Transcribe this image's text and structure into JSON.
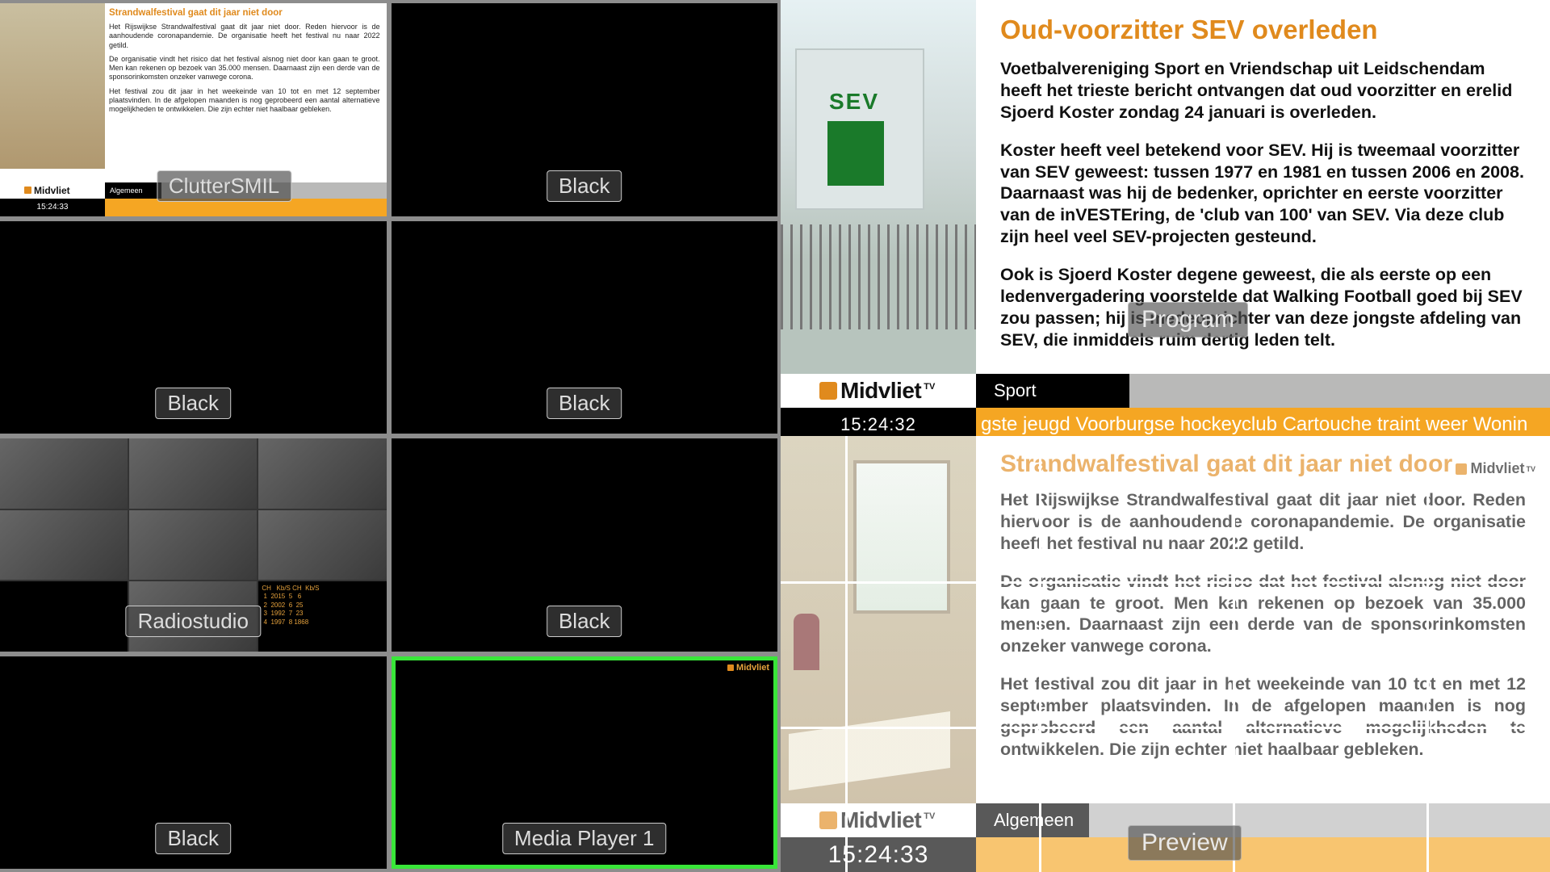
{
  "brand": {
    "name": "Midvliet",
    "suffix": "TV"
  },
  "program": {
    "source_label": "Program",
    "headline": "Oud-voorzitter SEV overleden",
    "photo_sign": "SEV",
    "paragraphs": [
      "Voetbalvereniging Sport en Vriendschap uit Leidschendam heeft het trieste bericht ontvangen dat oud voorzitter en erelid Sjoerd Koster zondag 24 januari is overleden.",
      "Koster heeft veel betekend voor SEV. Hij is tweemaal voorzitter van SEV geweest: tussen 1977 en 1981 en tussen 2006 en 2008. Daarnaast was hij de bedenker, oprichter en eerste voorzitter van de inVESTEring, de 'club van 100' van SEV. Via deze club zijn heel veel SEV-projecten gesteund.",
      "Ook is Sjoerd Koster degene geweest, die als eerste op een ledenvergadering voorstelde dat Walking Football goed bij SEV zou passen; hij is medeoprichter van deze jongste afdeling van SEV, die inmiddels ruim dertig leden telt."
    ],
    "category": "Sport",
    "time": "15:24:32",
    "ticker": "gste jeugd Voorburgse hockeyclub Cartouche traint weer        Wonin"
  },
  "preview": {
    "source_label": "Preview",
    "headline": "Strandwalfestival gaat dit jaar niet door",
    "paragraphs": [
      "Het Rijswijkse Strandwalfestival gaat dit jaar niet door. Reden hiervoor is de aanhoudende coronapandemie. De organisatie heeft het festival nu naar 2022 getild.",
      "De organisatie vindt het risico dat het festival alsnog niet door kan gaan te groot. Men kan rekenen op bezoek van 35.000 mensen. Daarnaast zijn een derde van de sponsorinkomsten onzeker vanwege corona.",
      "Het festival zou dit jaar in het weekeinde van 10 tot en met 12 september plaatsvinden. In de afgelopen maanden is nog geprobeerd een aantal alternatieve mogelijkheden te ontwikkelen. Die zijn echter niet haalbaar gebleken."
    ],
    "category": "Algemeen",
    "time": "15:24:33"
  },
  "mv": {
    "cells": [
      {
        "label": "ClutterSMIL",
        "selected": true
      },
      {
        "label": "Black",
        "selected": false
      },
      {
        "label": "Black",
        "selected": false
      },
      {
        "label": "Black",
        "selected": false
      },
      {
        "label": "Radiostudio",
        "selected": false
      },
      {
        "label": "Black",
        "selected": false
      },
      {
        "label": "Black",
        "selected": false
      },
      {
        "label": "Media Player 1",
        "selected": true
      }
    ],
    "mini": {
      "headline": "Strandwalfestival gaat dit jaar niet door",
      "paragraphs": [
        "Het Rijswijkse Strandwalfestival gaat dit jaar niet door. Reden hiervoor is de aanhoudende coronapandemie. De organisatie heeft het festival nu naar 2022 getild.",
        "De organisatie vindt het risico dat het festival alsnog niet door kan gaan te groot. Men kan rekenen op bezoek van 35.000 mensen. Daarnaast zijn een derde van de sponsorinkomsten onzeker vanwege corona.",
        "Het festival zou dit jaar in het weekeinde van 10 tot en met 12 september plaatsvinden. In de afgelopen maanden is nog geprobeerd een aantal alternatieve mogelijkheden te ontwikkelen. Die zijn echter niet haalbaar gebleken."
      ],
      "category": "Algemeen",
      "time": "15:24:33"
    },
    "radiostudio_meta": "CH   Kb/S CH  Kb/S\n 1  2015  5   6\n 2  2002  6  25\n 3  1992  7  23\n 4  1997  8 1868"
  }
}
